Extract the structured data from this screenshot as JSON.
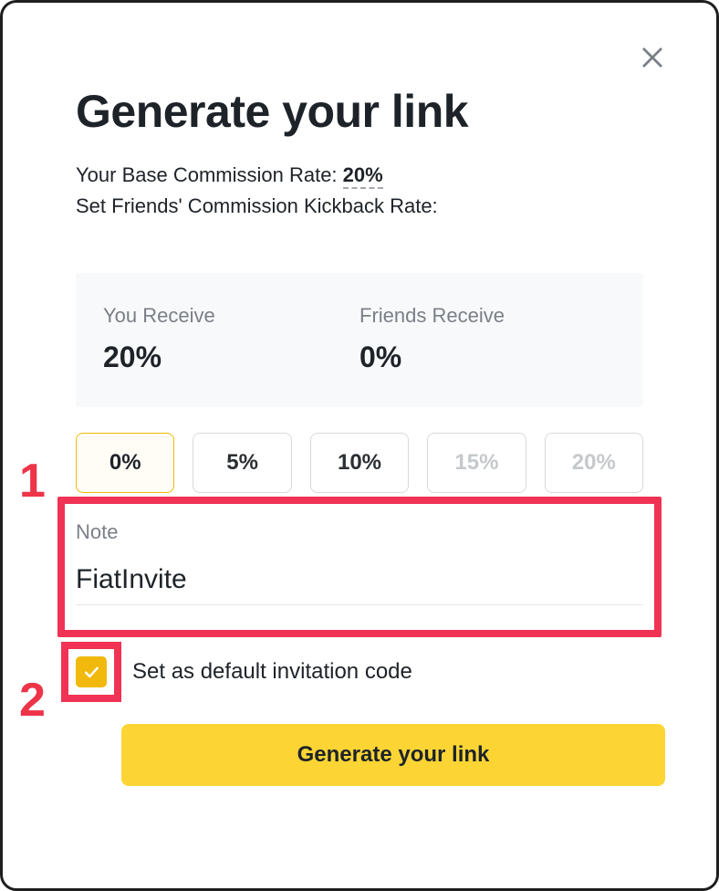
{
  "modal": {
    "title": "Generate your link",
    "base_rate_label": "Your Base Commission Rate:",
    "base_rate_value": "20%",
    "kickback_label": "Set Friends' Commission Kickback Rate:"
  },
  "split": {
    "you_label": "You Receive",
    "you_value": "20%",
    "friends_label": "Friends Receive",
    "friends_value": "0%"
  },
  "options": [
    {
      "label": "0%",
      "selected": true,
      "disabled": false
    },
    {
      "label": "5%",
      "selected": false,
      "disabled": false
    },
    {
      "label": "10%",
      "selected": false,
      "disabled": false
    },
    {
      "label": "15%",
      "selected": false,
      "disabled": true
    },
    {
      "label": "20%",
      "selected": false,
      "disabled": true
    }
  ],
  "note": {
    "label": "Note",
    "value": "FiatInvite"
  },
  "default_checkbox": {
    "checked": true,
    "label": "Set as default invitation code"
  },
  "button": {
    "generate": "Generate your link"
  },
  "annotations": {
    "marker1": "1",
    "marker2": "2"
  },
  "colors": {
    "accent": "#f0b90b",
    "button_bg": "#fcd535",
    "annotation_red": "#f03354",
    "text_primary": "#1e2329",
    "text_muted": "#7a7f87",
    "panel_bg": "#f8f9fa"
  }
}
